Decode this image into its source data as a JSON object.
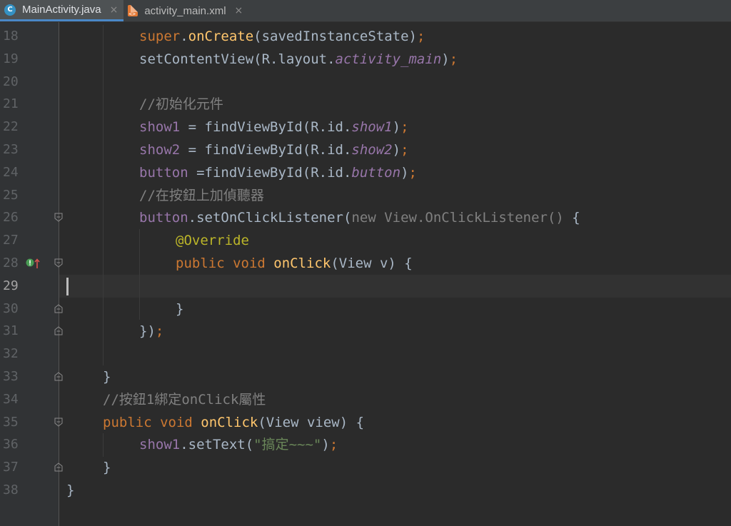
{
  "tabs": [
    {
      "label": "MainActivity.java",
      "icon": "java-class-icon",
      "active": true
    },
    {
      "label": "activity_main.xml",
      "icon": "xml-file-icon",
      "active": false
    }
  ],
  "tab_close_glyph": "×",
  "current_line": "29",
  "lines": [
    {
      "n": "18",
      "parts": [
        [
          "kw",
          "super"
        ],
        [
          "",
          "."
        ],
        [
          "fn",
          "onCreate"
        ],
        [
          "",
          "(savedInstanceState)"
        ],
        [
          "kw",
          ";"
        ]
      ]
    },
    {
      "n": "19",
      "parts": [
        [
          "",
          "setContentView(R.layout."
        ],
        [
          "fld",
          "activity_main"
        ],
        [
          "",
          ")"
        ],
        [
          "kw",
          ";"
        ]
      ]
    },
    {
      "n": "20",
      "parts": []
    },
    {
      "n": "21",
      "parts": [
        [
          "cmt",
          "//初始化元件"
        ]
      ]
    },
    {
      "n": "22",
      "parts": [
        [
          "var",
          "show1"
        ],
        [
          "",
          " = findViewById(R.id."
        ],
        [
          "fld",
          "show1"
        ],
        [
          "",
          ")"
        ],
        [
          "kw",
          ";"
        ]
      ]
    },
    {
      "n": "23",
      "parts": [
        [
          "var",
          "show2"
        ],
        [
          "",
          " = findViewById(R.id."
        ],
        [
          "fld",
          "show2"
        ],
        [
          "",
          ")"
        ],
        [
          "kw",
          ";"
        ]
      ]
    },
    {
      "n": "24",
      "parts": [
        [
          "var",
          "button"
        ],
        [
          "",
          " =findViewById(R.id."
        ],
        [
          "fld",
          "button"
        ],
        [
          "",
          ")"
        ],
        [
          "kw",
          ";"
        ]
      ]
    },
    {
      "n": "25",
      "parts": [
        [
          "cmt",
          "//在按鈕上加偵聽器"
        ]
      ]
    },
    {
      "n": "26",
      "parts": [
        [
          "var",
          "button"
        ],
        [
          "",
          "."
        ],
        [
          "",
          "setOnClickListener("
        ],
        [
          "grey",
          "new View.OnClickListener()"
        ],
        [
          "",
          " {"
        ]
      ]
    },
    {
      "n": "27",
      "parts": [
        [
          "ann",
          "@Override"
        ]
      ]
    },
    {
      "n": "28",
      "parts": [
        [
          "kw",
          "public void "
        ],
        [
          "fn",
          "onClick"
        ],
        [
          "",
          "(View v) {"
        ]
      ]
    },
    {
      "n": "29",
      "parts": []
    },
    {
      "n": "30",
      "parts": [
        [
          "",
          "}"
        ]
      ]
    },
    {
      "n": "31",
      "parts": [
        [
          "",
          "})"
        ],
        [
          "kw",
          ";"
        ]
      ]
    },
    {
      "n": "32",
      "parts": []
    },
    {
      "n": "33",
      "parts": [
        [
          "",
          "}"
        ]
      ]
    },
    {
      "n": "34",
      "parts": [
        [
          "cmt",
          "//按鈕1綁定onClick屬性"
        ]
      ]
    },
    {
      "n": "35",
      "parts": [
        [
          "kw",
          "public void "
        ],
        [
          "fn",
          "onClick"
        ],
        [
          "",
          "(View view) {"
        ]
      ]
    },
    {
      "n": "36",
      "parts": [
        [
          "var",
          "show1"
        ],
        [
          "",
          ".setText("
        ],
        [
          "str",
          "\"搞定~~~\""
        ],
        [
          "",
          ")"
        ],
        [
          "kw",
          ";"
        ]
      ]
    },
    {
      "n": "37",
      "parts": [
        [
          "",
          "}"
        ]
      ]
    },
    {
      "n": "38",
      "parts": [
        [
          "",
          "}"
        ]
      ]
    }
  ]
}
